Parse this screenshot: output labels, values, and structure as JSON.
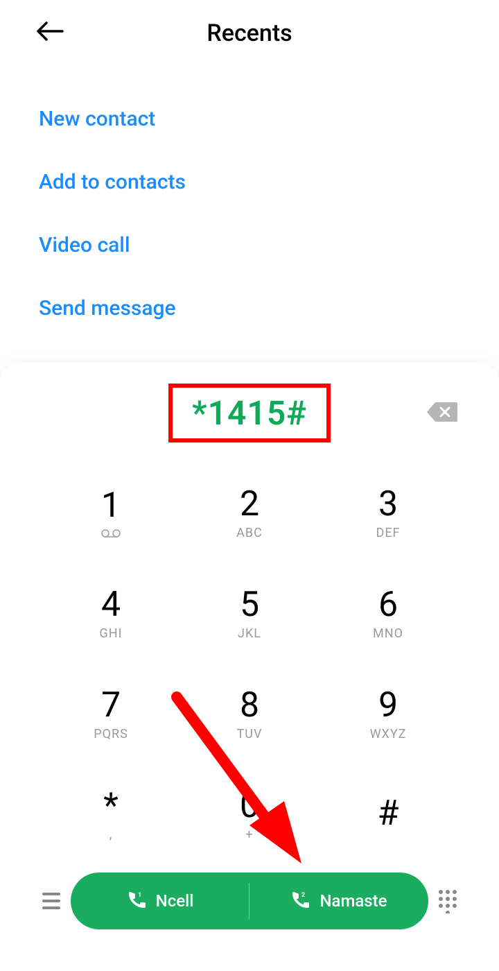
{
  "header": {
    "title": "Recents"
  },
  "actions": {
    "new_contact": "New contact",
    "add_to_contacts": "Add to contacts",
    "video_call": "Video call",
    "send_message": "Send message"
  },
  "dialer": {
    "number": "*1415#",
    "keys": [
      {
        "num": "1",
        "letters": ""
      },
      {
        "num": "2",
        "letters": "ABC"
      },
      {
        "num": "3",
        "letters": "DEF"
      },
      {
        "num": "4",
        "letters": "GHI"
      },
      {
        "num": "5",
        "letters": "JKL"
      },
      {
        "num": "6",
        "letters": "MNO"
      },
      {
        "num": "7",
        "letters": "PQRS"
      },
      {
        "num": "8",
        "letters": "TUV"
      },
      {
        "num": "9",
        "letters": "WXYZ"
      },
      {
        "num": "*",
        "letters": ","
      },
      {
        "num": "0",
        "letters": "+"
      },
      {
        "num": "#",
        "letters": ""
      }
    ],
    "call_buttons": {
      "left": "Ncell",
      "right": "Namaste"
    }
  },
  "colors": {
    "action_link": "#1a8cff",
    "number_display": "#0fa958",
    "call_button": "#1aad5f",
    "highlight_box": "#ff0000",
    "annotation_arrow": "#ff0000"
  }
}
